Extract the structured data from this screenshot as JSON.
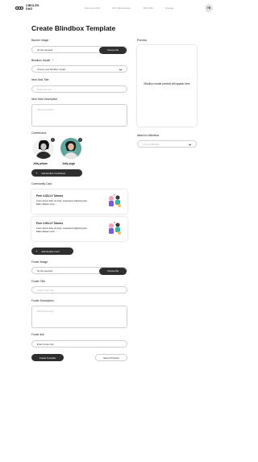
{
  "nav": {
    "logo_line1": "CIRCLES",
    "logo_line2": "DAO",
    "links": [
      "Discover DAO",
      "NFT Marketplace",
      "Blind Box",
      "Engage"
    ],
    "avatar_initials": "YB"
  },
  "page": {
    "title": "Create  Blindbox Template"
  },
  "form": {
    "banner_image": {
      "label": "Banner Image",
      "file_status": "No file selected",
      "button": "Choose file"
    },
    "blindbox_model": {
      "label": "Blindbox Model",
      "required_mark": "*",
      "placeholder": "choose your blindbox model"
    },
    "item_sets_title": {
      "label": "Item Sets Title",
      "placeholder": "Enter item title"
    },
    "item_sets_description": {
      "label": "Item Sets Description",
      "placeholder": "Write Description"
    },
    "contributors": {
      "label": "Contributors",
      "people": [
        {
          "name": "Jolly prilam",
          "remove": "×"
        },
        {
          "name": "Jolly yoga",
          "remove": "×"
        }
      ],
      "add_button": "Add another Contributor"
    },
    "community_card": {
      "label": "Community Card",
      "cards": [
        {
          "title": "Free #JOLLY Tokens",
          "body": "Lorem ipsum dolor sit amet, consectetur adipiscing elit. Etiam aliquam nunc ..."
        },
        {
          "title": "Free #JOLLY Tokens",
          "body": "Lorem ipsum dolor sit amet, consectetur adipiscing elit. Etiam aliquam nunc ..."
        }
      ],
      "add_button": "Add another Card"
    },
    "footer_image": {
      "label": "Footer Image",
      "file_status": "No file selected",
      "button": "Choose file"
    },
    "footer_title": {
      "label": "Footer Title",
      "placeholder": "Enter Footer title"
    },
    "footer_description": {
      "label": "Footer Description",
      "placeholder": "Write Description"
    },
    "footer_link": {
      "label": "Footer link",
      "value": "Enter Footer link"
    }
  },
  "preview": {
    "label": "Preview",
    "placeholder_text": "Blindbox model preview will appear here"
  },
  "attach": {
    "label": "Attach to Blindbox",
    "placeholder": "Choose Blindbox"
  },
  "actions": {
    "create": "Create Template",
    "save": "Save & Preview"
  },
  "colors": {
    "dark_button": "#2f2f2f",
    "border": "#cfcfcf",
    "muted": "#9a9a9a"
  }
}
